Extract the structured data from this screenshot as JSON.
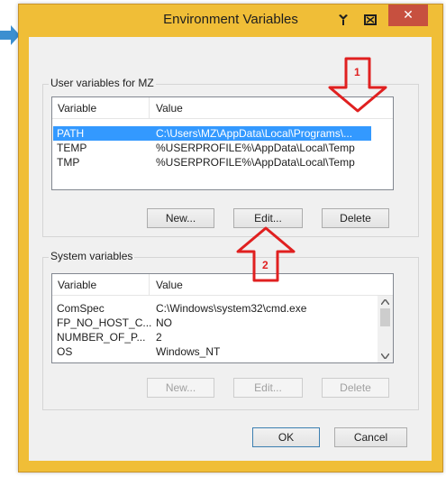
{
  "window": {
    "title": "Environment Variables",
    "close_glyph": "✕"
  },
  "user_vars": {
    "group_label": "User variables for MZ",
    "col_variable": "Variable",
    "col_value": "Value",
    "rows": [
      {
        "variable": "PATH",
        "value": "C:\\Users\\MZ\\AppData\\Local\\Programs\\..."
      },
      {
        "variable": "TEMP",
        "value": "%USERPROFILE%\\AppData\\Local\\Temp"
      },
      {
        "variable": "TMP",
        "value": "%USERPROFILE%\\AppData\\Local\\Temp"
      }
    ],
    "new_label": "New...",
    "edit_label": "Edit...",
    "delete_label": "Delete"
  },
  "system_vars": {
    "group_label": "System variables",
    "col_variable": "Variable",
    "col_value": "Value",
    "rows": [
      {
        "variable": "ComSpec",
        "value": "C:\\Windows\\system32\\cmd.exe"
      },
      {
        "variable": "FP_NO_HOST_C...",
        "value": "NO"
      },
      {
        "variable": "NUMBER_OF_P...",
        "value": "2"
      },
      {
        "variable": "OS",
        "value": "Windows_NT"
      }
    ],
    "new_label": "New...",
    "edit_label": "Edit...",
    "delete_label": "Delete"
  },
  "footer": {
    "ok_label": "OK",
    "cancel_label": "Cancel"
  },
  "annotations": {
    "arrow1_label": "1",
    "arrow2_label": "2"
  },
  "colors": {
    "window_frame": "#f0be37",
    "selection": "#3399ff",
    "close_button": "#c7503f",
    "annotation_red": "#e02020"
  }
}
